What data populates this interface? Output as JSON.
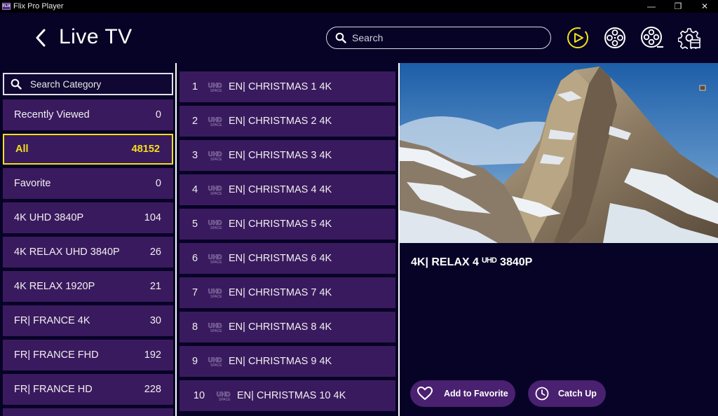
{
  "window": {
    "logo_text": "FLIX",
    "title": "Flix Pro Player",
    "minimize": "—",
    "restore": "❐",
    "close": "✕"
  },
  "header": {
    "title": "Live TV",
    "search_placeholder": "Search",
    "icons": [
      "play-circle-icon",
      "film-reel-icon",
      "film-reel-alt-icon",
      "settings-gear-icon"
    ],
    "accent_color": "#f2e01c"
  },
  "categories": {
    "search_placeholder": "Search Category",
    "items": [
      {
        "label": "Recently Viewed",
        "count": "0"
      },
      {
        "label": "All",
        "count": "48152",
        "active": true
      },
      {
        "label": "Favorite",
        "count": "0"
      },
      {
        "label": "4K UHD 3840P",
        "count": "104"
      },
      {
        "label": "4K RELAX UHD 3840P",
        "count": "26"
      },
      {
        "label": "4K RELAX 1920P",
        "count": "21"
      },
      {
        "label": "FR| FRANCE 4K",
        "count": "30"
      },
      {
        "label": "FR| FRANCE FHD",
        "count": "192"
      },
      {
        "label": "FR| FRANCE HD",
        "count": "228"
      }
    ]
  },
  "channels": {
    "items": [
      {
        "num": "1",
        "name": "EN| CHRISTMAS 1 4K"
      },
      {
        "num": "2",
        "name": "EN| CHRISTMAS 2 4K"
      },
      {
        "num": "3",
        "name": "EN| CHRISTMAS 3 4K"
      },
      {
        "num": "4",
        "name": "EN| CHRISTMAS 4 4K"
      },
      {
        "num": "5",
        "name": "EN| CHRISTMAS 5 4K"
      },
      {
        "num": "6",
        "name": "EN| CHRISTMAS 6 4K"
      },
      {
        "num": "7",
        "name": "EN| CHRISTMAS 7 4K"
      },
      {
        "num": "8",
        "name": "EN| CHRISTMAS 8 4K"
      },
      {
        "num": "9",
        "name": "EN| CHRISTMAS 9 4K"
      },
      {
        "num": "10",
        "name": "EN| CHRISTMAS 10 4K"
      }
    ]
  },
  "player": {
    "now_playing": "4K| RELAX 4 ᵁᴴᴰ 3840P",
    "add_favorite_label": "Add to Favorite",
    "catch_up_label": "Catch Up"
  }
}
